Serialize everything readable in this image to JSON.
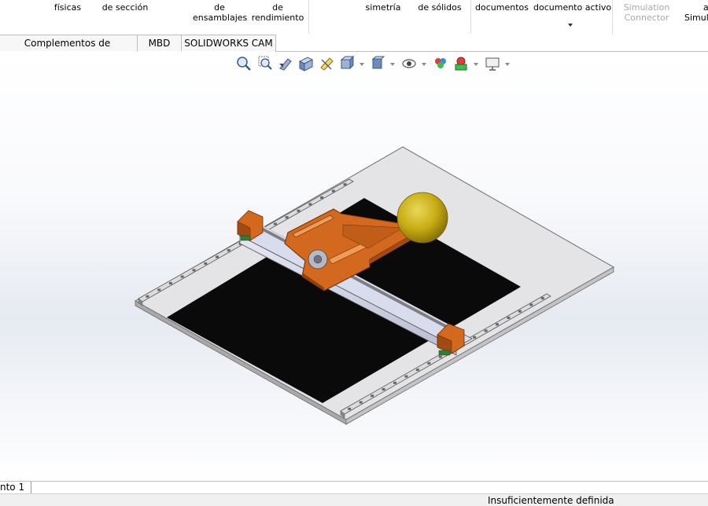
{
  "ribbon": {
    "commands": [
      {
        "id": "fisicas",
        "lines": [
          "físicas"
        ],
        "enabled": true
      },
      {
        "id": "seccion",
        "lines": [
          "de sección"
        ],
        "enabled": true
      },
      {
        "id": "ensamblajes",
        "lines": [
          "de",
          "ensamblajes"
        ],
        "enabled": true
      },
      {
        "id": "rendimiento",
        "lines": [
          "de",
          "rendimiento"
        ],
        "enabled": true
      },
      {
        "id": "simetria",
        "lines": [
          "simetría"
        ],
        "enabled": true
      },
      {
        "id": "solidos",
        "lines": [
          "de sólidos"
        ],
        "enabled": true
      },
      {
        "id": "documentos",
        "lines": [
          "documentos"
        ],
        "enabled": true
      },
      {
        "id": "documento-activo",
        "lines": [
          "documento activo"
        ],
        "enabled": true,
        "dropdown": true
      },
      {
        "id": "simulation-connector",
        "lines": [
          "Simulation",
          "Connector"
        ],
        "enabled": false
      },
      {
        "id": "simula",
        "lines": [
          "a",
          "Simula"
        ],
        "enabled": true
      }
    ]
  },
  "tabs": [
    "Complementos de SOLIDWORKS",
    "MBD",
    "SOLIDWORKS CAM"
  ],
  "heads_up_toolbar": {
    "icons": [
      "zoom-to-fit-icon",
      "zoom-to-area-icon",
      "previous-view-icon",
      "section-view-icon",
      "dynamic-annotation-views-icon",
      "view-orientation-icon",
      "display-style-icon",
      "hide-show-items-icon",
      "edit-appearance-icon",
      "apply-scene-icon",
      "view-settings-icon"
    ]
  },
  "scene": {
    "model": "linear-axis-assembly",
    "colors": {
      "plate": "#e2e2e4",
      "black_pad": "#090909",
      "part_orange": "#d2691e",
      "part_orange_dark": "#a14b12",
      "sphere": "#c8b014",
      "rail": "#c4c4cc",
      "rod": "#a9a9b2",
      "connector_green": "#2e7d32"
    }
  },
  "status": {
    "model_tab": "nto 1",
    "definition": "Insuficientemente definida"
  }
}
